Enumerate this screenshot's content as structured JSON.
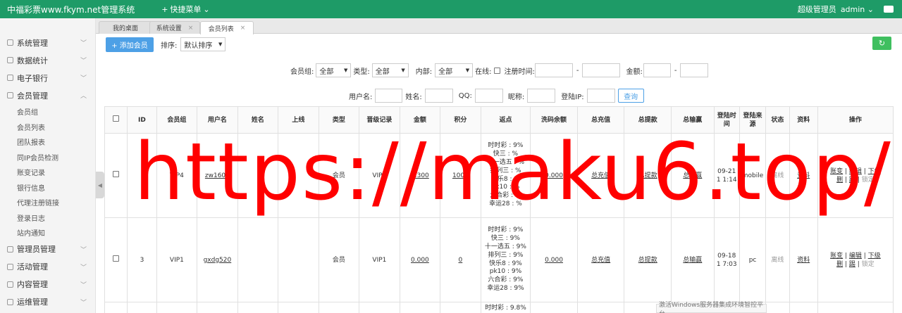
{
  "topbar": {
    "brand": "中福彩票www.fkym.net管理系统",
    "quick_menu": "快捷菜单",
    "role": "超级管理员",
    "user": "admin"
  },
  "sidebar": {
    "groups_top": [
      {
        "label": "系统管理",
        "icon": "gear-icon"
      },
      {
        "label": "数据统计",
        "icon": "chart-icon"
      },
      {
        "label": "电子银行",
        "icon": "list-icon"
      },
      {
        "label": "会员管理",
        "icon": "user-icon"
      }
    ],
    "subs": [
      "会员组",
      "会员列表",
      "团队报表",
      "同IP会员检测",
      "账变记录",
      "银行信息",
      "代理注册链接",
      "登录日志",
      "站内通知"
    ],
    "groups_bottom": [
      {
        "label": "管理员管理",
        "icon": "user-icon"
      },
      {
        "label": "活动管理",
        "icon": "gift-icon"
      },
      {
        "label": "内容管理",
        "icon": "doc-icon"
      },
      {
        "label": "运维管理",
        "icon": "tool-icon"
      }
    ]
  },
  "tabs": [
    {
      "label": "我的桌面"
    },
    {
      "label": "系统设置"
    },
    {
      "label": "会员列表"
    }
  ],
  "toolbar": {
    "add_label": "+ 添加会员",
    "sort_label": "排序:",
    "sort_value": "默认排序"
  },
  "filters": {
    "group_label": "会员组:",
    "group_value": "全部",
    "type_label": "类型:",
    "type_value": "全部",
    "internal_label": "内部:",
    "internal_value": "全部",
    "online_label": "在线:",
    "regtime_label": "注册时间:",
    "dash": "-",
    "amount_label": "金额:",
    "username_label": "用户名:",
    "name_label": "姓名:",
    "qq_label": "QQ:",
    "nick_label": "昵称:",
    "ip_label": "登陆IP:",
    "search_label": "查询"
  },
  "table": {
    "headers": [
      "ID",
      "会员组",
      "用户名",
      "姓名",
      "上线",
      "类型",
      "晋级记录",
      "金额",
      "积分",
      "返点",
      "洗码余额",
      "总充值",
      "总提款",
      "总输赢",
      "登陆时间",
      "登陆来源",
      "状态",
      "资料",
      "操作"
    ],
    "rows": [
      {
        "id": "",
        "group": "VIP4",
        "username": "zw1603",
        "name": "",
        "upline": "",
        "type": "会员",
        "promo": "VIP1",
        "amount": "7.300",
        "points": "1000",
        "rebate": [
          "时时彩 : 9%",
          "快三 : %",
          "十一选五 : %",
          "排列三 : %",
          "快乐8 : %",
          "pk10 : %",
          "六合彩 : %",
          "幸运28 : %"
        ],
        "wash": "0.000",
        "recharge": "总充值",
        "withdraw": "总提款",
        "winloss": "总输赢",
        "login_time": "09-21 1 1:14",
        "source": "mobile",
        "status": "离线",
        "profile": "资料",
        "ops1": [
          "账变",
          "编辑",
          "下级"
        ],
        "ops2": [
          "删",
          "踢",
          "锁定"
        ]
      },
      {
        "id": "3",
        "group": "VIP1",
        "username": "gxdg520",
        "name": "",
        "upline": "",
        "type": "会员",
        "promo": "VIP1",
        "amount": "0.000",
        "points": "0",
        "rebate": [
          "时时彩 : 9%",
          "快三 : 9%",
          "十一选五 : 9%",
          "排列三 : 9%",
          "快乐8 : 9%",
          "pk10 : 9%",
          "六合彩 : 9%",
          "幸运28 : 9%"
        ],
        "wash": "0.000",
        "recharge": "总充值",
        "withdraw": "总提款",
        "winloss": "总输赢",
        "login_time": "09-18 1 7:03",
        "source": "pc",
        "status": "离线",
        "profile": "资料",
        "ops1": [
          "账变",
          "编辑",
          "下级"
        ],
        "ops2": [
          "删",
          "踢",
          "锁定"
        ]
      },
      {
        "rebate_first": "时时彩 : 9.8%"
      }
    ]
  },
  "watermark": "https://maku6.top/",
  "activation_text": "激活Windows服务器集成环境智控平台",
  "colors": {
    "topbar": "#1e9b67",
    "primary_button": "#4da0e6",
    "refresh_button": "#3fbf5f",
    "watermark": "#ff0000"
  }
}
